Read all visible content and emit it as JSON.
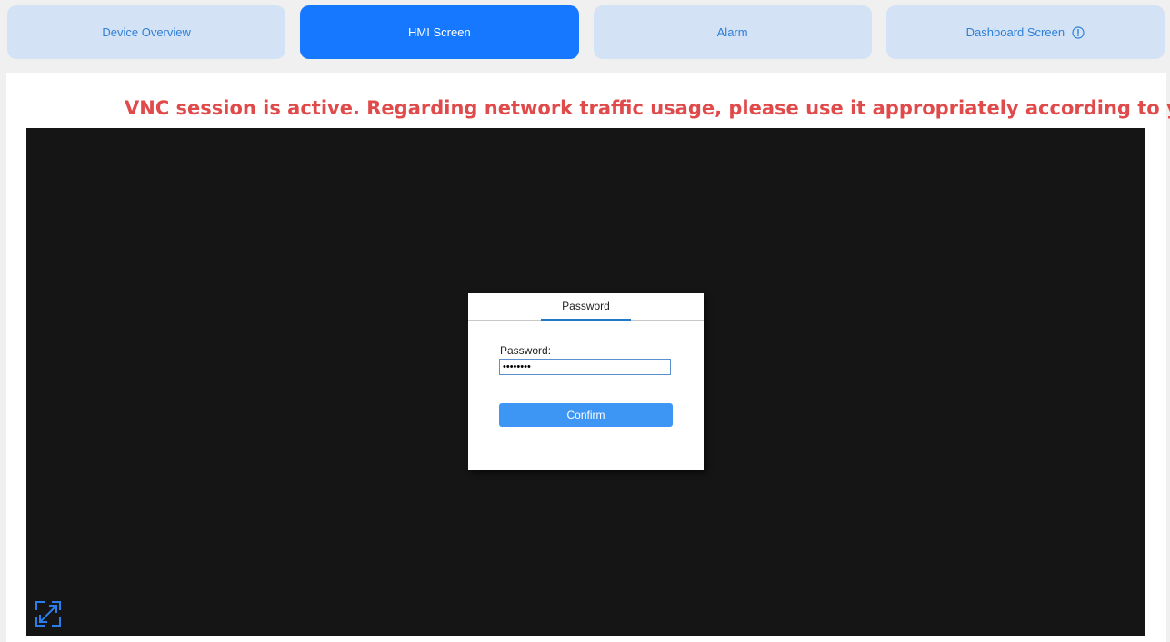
{
  "tabs": [
    {
      "label": "Device Overview",
      "active": false
    },
    {
      "label": "HMI Screen",
      "active": true
    },
    {
      "label": "Alarm",
      "active": false
    },
    {
      "label": "Dashboard Screen",
      "active": false,
      "icon": "info-circle-icon"
    }
  ],
  "banner": {
    "text": "VNC session is active. Regarding network traffic usage, please use it appropriately according to you",
    "color": "#e04a4a"
  },
  "vnc": {
    "background": "#151515",
    "dialog": {
      "tab_label": "Password",
      "field_label": "Password:",
      "field_value": "••••••••",
      "confirm_label": "Confirm"
    },
    "expand_icon": "expand-arrows-icon"
  },
  "colors": {
    "accent": "#1677ff",
    "tab_inactive_bg": "#d3e3f5",
    "tab_inactive_text": "#2f7fd7",
    "confirm_bg": "#3d96f4"
  }
}
